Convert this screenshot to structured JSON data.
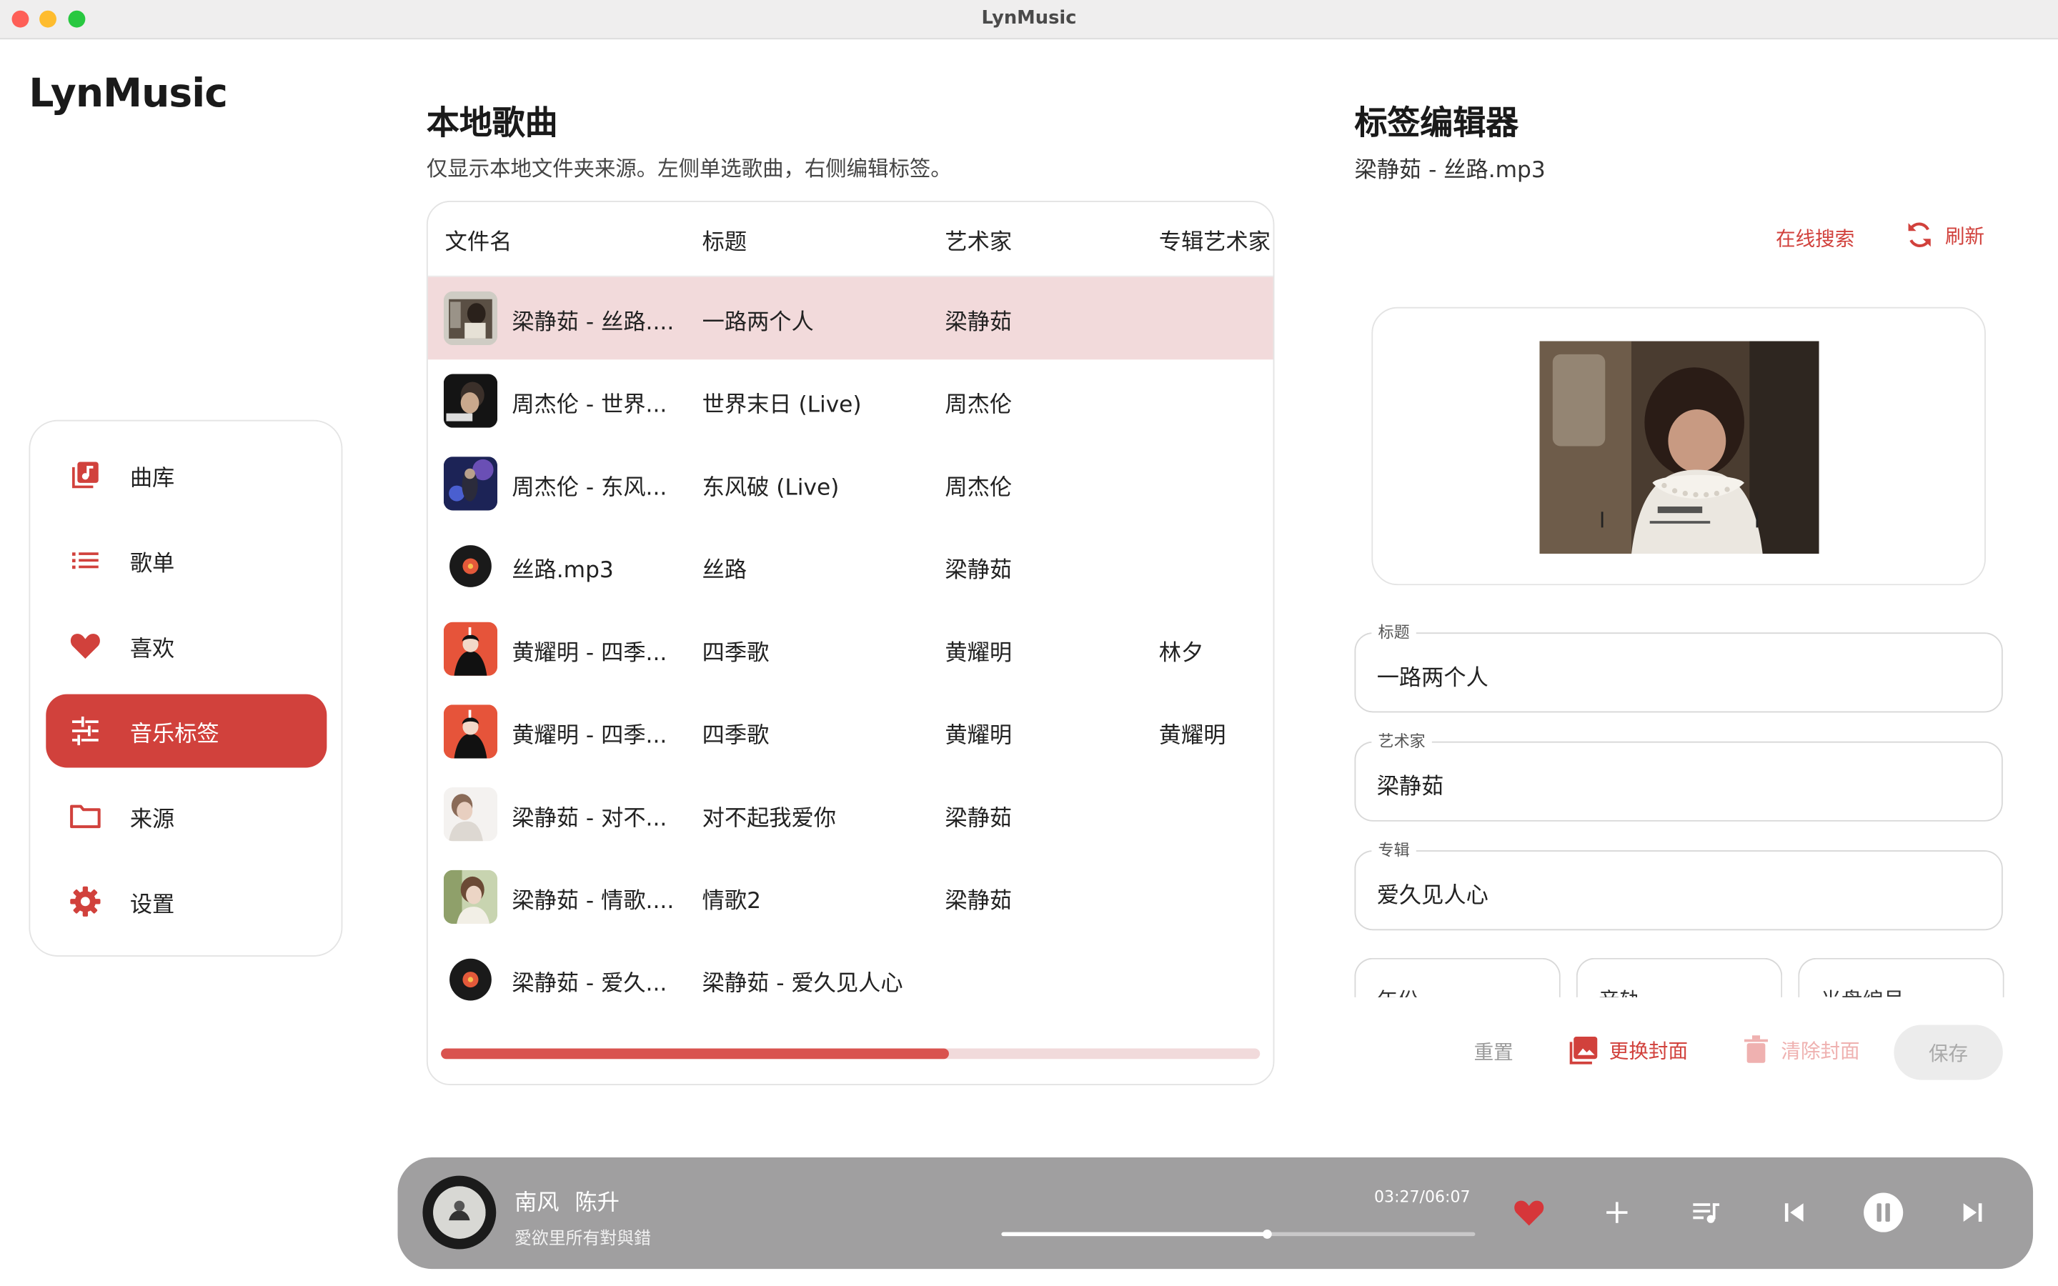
{
  "window": {
    "title": "LynMusic"
  },
  "app": {
    "logo": "LynMusic"
  },
  "sidebar": {
    "items": [
      {
        "label": "曲库",
        "icon": "music-library-icon"
      },
      {
        "label": "歌单",
        "icon": "list-icon"
      },
      {
        "label": "喜欢",
        "icon": "heart-icon"
      },
      {
        "label": "音乐标签",
        "icon": "tune-icon",
        "active": true
      },
      {
        "label": "来源",
        "icon": "folder-icon"
      },
      {
        "label": "设置",
        "icon": "gear-icon"
      }
    ]
  },
  "local": {
    "title": "本地歌曲",
    "subtitle": "仅显示本地文件夹来源。左侧单选歌曲，右侧编辑标签。",
    "columns": [
      "文件名",
      "标题",
      "艺术家",
      "专辑艺术家"
    ],
    "rows": [
      {
        "file": "梁静茹 - 丝路....",
        "title": "一路两个人",
        "artist": "梁静茹",
        "album_artist": "",
        "selected": true
      },
      {
        "file": "周杰伦 - 世界...",
        "title": "世界末日 (Live)",
        "artist": "周杰伦",
        "album_artist": ""
      },
      {
        "file": "周杰伦 - 东风...",
        "title": "东风破 (Live)",
        "artist": "周杰伦",
        "album_artist": ""
      },
      {
        "file": "丝路.mp3",
        "title": "丝路",
        "artist": "梁静茹",
        "album_artist": ""
      },
      {
        "file": "黄耀明 - 四季...",
        "title": "四季歌",
        "artist": "黄耀明",
        "album_artist": "林夕"
      },
      {
        "file": "黄耀明 - 四季...",
        "title": "四季歌",
        "artist": "黄耀明",
        "album_artist": "黄耀明"
      },
      {
        "file": "梁静茹 - 对不...",
        "title": "对不起我爱你",
        "artist": "梁静茹",
        "album_artist": ""
      },
      {
        "file": "梁静茹 - 情歌....",
        "title": "情歌2",
        "artist": "梁静茹",
        "album_artist": ""
      },
      {
        "file": "梁静茹 - 爱久...",
        "title": "梁静茹 - 爱久见人心",
        "artist": "",
        "album_artist": ""
      }
    ],
    "scroll_fraction": 0.62
  },
  "editor": {
    "title": "标签编辑器",
    "file": "梁静茹 - 丝路.mp3",
    "online_search": "在线搜索",
    "refresh": "刷新",
    "fields": [
      {
        "label": "标题",
        "value": "一路两个人"
      },
      {
        "label": "艺术家",
        "value": "梁静茹"
      },
      {
        "label": "专辑",
        "value": "爱久见人心"
      }
    ],
    "small_fields": [
      "年份",
      "音轨",
      "光盘编号"
    ],
    "actions": {
      "reset": "重置",
      "replace_cover": "更换封面",
      "clear_cover": "清除封面",
      "save": "保存"
    }
  },
  "player": {
    "song": "南风",
    "artist": "陈升",
    "album": "愛欲里所有對與錯",
    "time": "03:27/06:07",
    "progress": 0.56
  },
  "colors": {
    "accent": "#d1413c",
    "selected_row": "#f2dadb",
    "player_bg": "#a09fa0"
  }
}
